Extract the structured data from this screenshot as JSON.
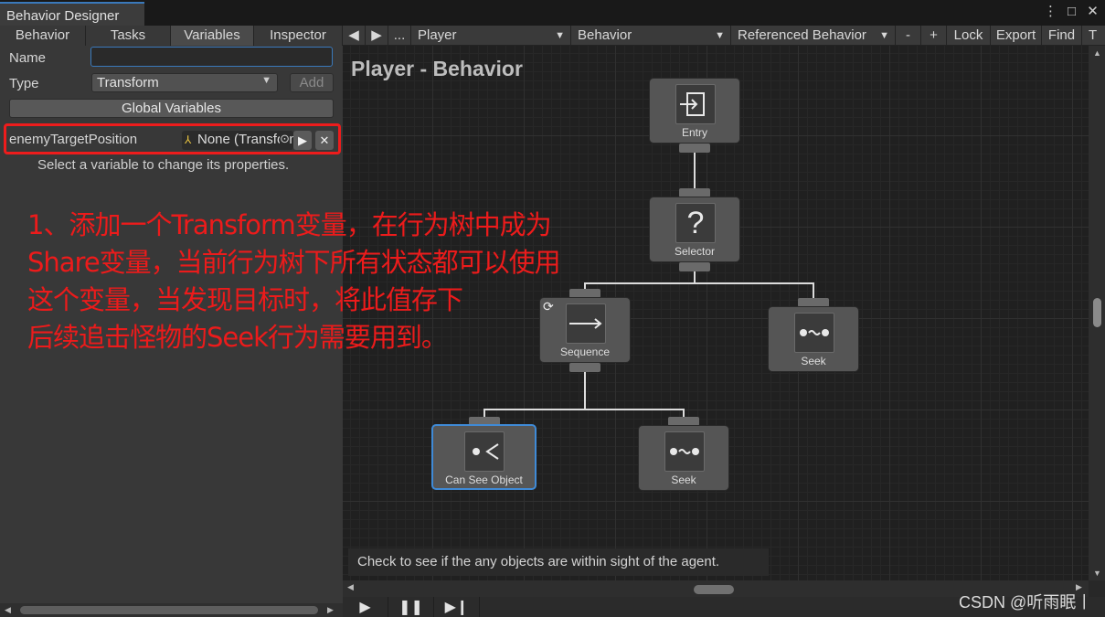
{
  "window": {
    "title": "Behavior Designer",
    "controls": [
      "⋮",
      "□",
      "✕"
    ]
  },
  "left_tabs": [
    "Behavior",
    "Tasks",
    "Variables",
    "Inspector"
  ],
  "variables_panel": {
    "name_label": "Name",
    "name_value": "",
    "type_label": "Type",
    "type_value": "Transform",
    "add_label": "Add",
    "global_label": "Global Variables",
    "variable": {
      "name": "enemyTargetPosition",
      "value": "None (Transform)"
    },
    "hint": "Select a variable to change its properties."
  },
  "graph_toolbar": {
    "back": "◀",
    "forward": "▶",
    "ellipsis": "...",
    "object_select": "Player",
    "behavior_select": "Behavior",
    "referenced": "Referenced Behavior",
    "minus": "-",
    "plus": "+",
    "lock": "Lock",
    "export": "Export",
    "find": "Find",
    "overflow": "T"
  },
  "graph": {
    "title": "Player - Behavior",
    "nodes": {
      "entry": "Entry",
      "selector": "Selector",
      "sequence": "Sequence",
      "seek_right": "Seek",
      "can_see": "Can See Object",
      "seek_bottom": "Seek"
    },
    "task_description": "Check to see if the any objects are within sight of the agent."
  },
  "annotation": [
    "1、添加一个Transform变量，在行为树中成为",
    "Share变量，当前行为树下所有状态都可以使用",
    "这个变量，当发现目标时，将此值存下",
    "后续追击怪物的Seek行为需要用到。"
  ],
  "watermark": "CSDN @听雨眠丨",
  "colors": {
    "annotation_red": "#ec1b1b",
    "selection_blue": "#3f8ad6",
    "panel_bg": "#383838",
    "graph_bg": "#202020"
  }
}
